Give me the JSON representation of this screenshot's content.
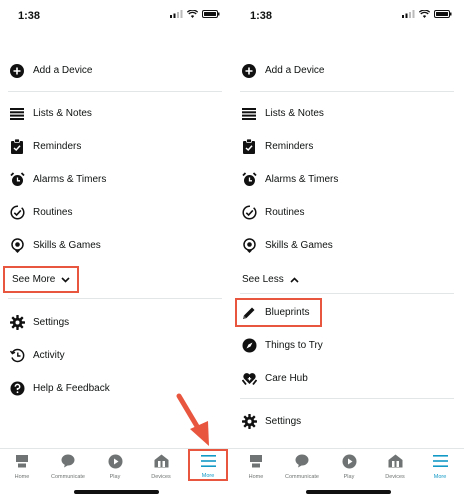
{
  "left": {
    "status": {
      "time": "1:38"
    },
    "menu": [
      {
        "id": "add-device",
        "label": "Add a Device",
        "icon": "plus-circle-icon"
      },
      {
        "id": "lists-notes",
        "label": "Lists & Notes",
        "icon": "list-icon"
      },
      {
        "id": "reminders",
        "label": "Reminders",
        "icon": "clipboard-check-icon"
      },
      {
        "id": "alarms-timers",
        "label": "Alarms & Timers",
        "icon": "alarm-clock-icon"
      },
      {
        "id": "routines",
        "label": "Routines",
        "icon": "check-circle-icon"
      },
      {
        "id": "skills-games",
        "label": "Skills & Games",
        "icon": "skills-target-icon"
      }
    ],
    "see_more": "See More",
    "bottom_menu": [
      {
        "id": "settings",
        "label": "Settings",
        "icon": "gear-icon"
      },
      {
        "id": "activity",
        "label": "Activity",
        "icon": "history-clock-icon"
      },
      {
        "id": "help",
        "label": "Help & Feedback",
        "icon": "question-circle-icon"
      }
    ],
    "active_tab": "more"
  },
  "right": {
    "status": {
      "time": "1:38"
    },
    "menu": [
      {
        "id": "add-device",
        "label": "Add a Device",
        "icon": "plus-circle-icon"
      },
      {
        "id": "lists-notes",
        "label": "Lists & Notes",
        "icon": "list-icon"
      },
      {
        "id": "reminders",
        "label": "Reminders",
        "icon": "clipboard-check-icon"
      },
      {
        "id": "alarms-timers",
        "label": "Alarms & Timers",
        "icon": "alarm-clock-icon"
      },
      {
        "id": "routines",
        "label": "Routines",
        "icon": "check-circle-icon"
      },
      {
        "id": "skills-games",
        "label": "Skills & Games",
        "icon": "skills-target-icon"
      }
    ],
    "see_less": "See Less",
    "expanded_menu": [
      {
        "id": "blueprints",
        "label": "Blueprints",
        "icon": "pencil-icon"
      },
      {
        "id": "things-to-try",
        "label": "Things to Try",
        "icon": "compass-icon"
      },
      {
        "id": "care-hub",
        "label": "Care Hub",
        "icon": "heart-hands-icon"
      }
    ],
    "bottom_menu": [
      {
        "id": "settings",
        "label": "Settings",
        "icon": "gear-icon"
      }
    ],
    "active_tab": "more"
  },
  "tabs": [
    {
      "id": "home",
      "label": "Home",
      "icon": "home-icon"
    },
    {
      "id": "communicate",
      "label": "Communicate",
      "icon": "chat-bubble-icon"
    },
    {
      "id": "play",
      "label": "Play",
      "icon": "play-icon"
    },
    {
      "id": "devices",
      "label": "Devices",
      "icon": "devices-house-icon"
    },
    {
      "id": "more",
      "label": "More",
      "icon": "hamburger-icon"
    }
  ],
  "colors": {
    "accent": "#1399c6",
    "highlight": "#e8563f",
    "text": "#0f1111",
    "divider": "#e3e6e6"
  }
}
